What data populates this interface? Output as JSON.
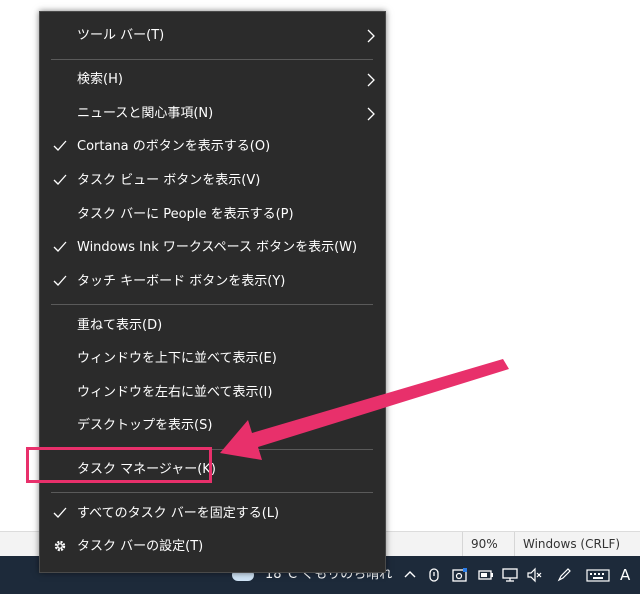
{
  "menu": {
    "items": [
      {
        "label": "ツール バー(T)",
        "checked": false,
        "submenu": true
      },
      {
        "label": "検索(H)",
        "checked": false,
        "submenu": true
      },
      {
        "label": "ニュースと関心事項(N)",
        "checked": false,
        "submenu": true
      },
      {
        "label": "Cortana のボタンを表示する(O)",
        "checked": true,
        "submenu": false
      },
      {
        "label": "タスク ビュー ボタンを表示(V)",
        "checked": true,
        "submenu": false
      },
      {
        "label": "タスク バーに People を表示する(P)",
        "checked": false,
        "submenu": false
      },
      {
        "label": "Windows Ink ワークスペース ボタンを表示(W)",
        "checked": true,
        "submenu": false
      },
      {
        "label": "タッチ キーボード ボタンを表示(Y)",
        "checked": true,
        "submenu": false
      },
      {
        "label": "重ねて表示(D)",
        "checked": false,
        "submenu": false
      },
      {
        "label": "ウィンドウを上下に並べて表示(E)",
        "checked": false,
        "submenu": false
      },
      {
        "label": "ウィンドウを左右に並べて表示(I)",
        "checked": false,
        "submenu": false
      },
      {
        "label": "デスクトップを表示(S)",
        "checked": false,
        "submenu": false
      },
      {
        "label": "タスク マネージャー(K)",
        "checked": false,
        "submenu": false
      },
      {
        "label": "すべてのタスク バーを固定する(L)",
        "checked": true,
        "submenu": false
      },
      {
        "label": "タスク バーの設定(T)",
        "checked": false,
        "submenu": false,
        "icon": "gear-icon"
      }
    ]
  },
  "status_bar": {
    "zoom": "90%",
    "line_ending": "Windows (CRLF)"
  },
  "taskbar": {
    "weather": "18°C くもりのち晴れ",
    "ime_indicator": "A"
  },
  "colors": {
    "menu_bg": "#2b2b2b",
    "annotation": "#e8306b",
    "taskbar_bg": "#1d2a3a"
  }
}
